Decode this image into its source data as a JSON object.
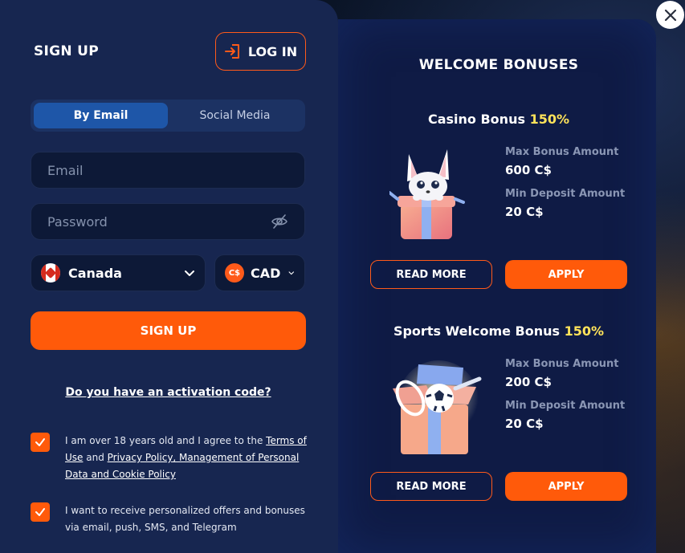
{
  "signup_panel": {
    "title": "SIGN UP",
    "login_label": "LOG IN",
    "tabs": [
      {
        "label": "By Email",
        "active": true
      },
      {
        "label": "Social Media",
        "active": false
      }
    ],
    "email_placeholder": "Email",
    "password_placeholder": "Password",
    "country": "Canada",
    "currency": "CAD",
    "currency_symbol": "C$",
    "submit_label": "SIGN UP",
    "activation_link": "Do you have an activation code?",
    "consent1": {
      "prefix": "I am over 18 years old and I agree to the ",
      "terms_link": "Terms of Use",
      "middle": " and ",
      "privacy_link": "Privacy Policy, Management of Personal Data and Cookie Policy",
      "checked": true
    },
    "consent2": {
      "text": "I want to receive personalized offers and bonuses via email, push, SMS, and Telegram",
      "checked": true
    }
  },
  "bonuses_panel": {
    "title": "WELCOME BONUSES",
    "bonuses": [
      {
        "name": "Casino Bonus",
        "percent": "150%",
        "max_label": "Max Bonus Amount",
        "max_value": "600 C$",
        "min_label": "Min Deposit Amount",
        "min_value": "20 C$",
        "read_more": "READ MORE",
        "apply": "APPLY"
      },
      {
        "name": "Sports Welcome Bonus",
        "percent": "150%",
        "max_label": "Max Bonus Amount",
        "max_value": "200 C$",
        "min_label": "Min Deposit Amount",
        "min_value": "20 C$",
        "read_more": "READ MORE",
        "apply": "APPLY"
      }
    ]
  },
  "colors": {
    "accent": "#ff5a0a",
    "highlight": "#ffe35a",
    "panel_left": "#172650",
    "panel_right": "#0f1b45"
  },
  "icons": [
    "login-icon",
    "eye-off-icon",
    "canada-flag-icon",
    "chevron-down-icon",
    "check-icon",
    "close-icon",
    "fox-gift-illustration",
    "sports-gift-illustration"
  ]
}
